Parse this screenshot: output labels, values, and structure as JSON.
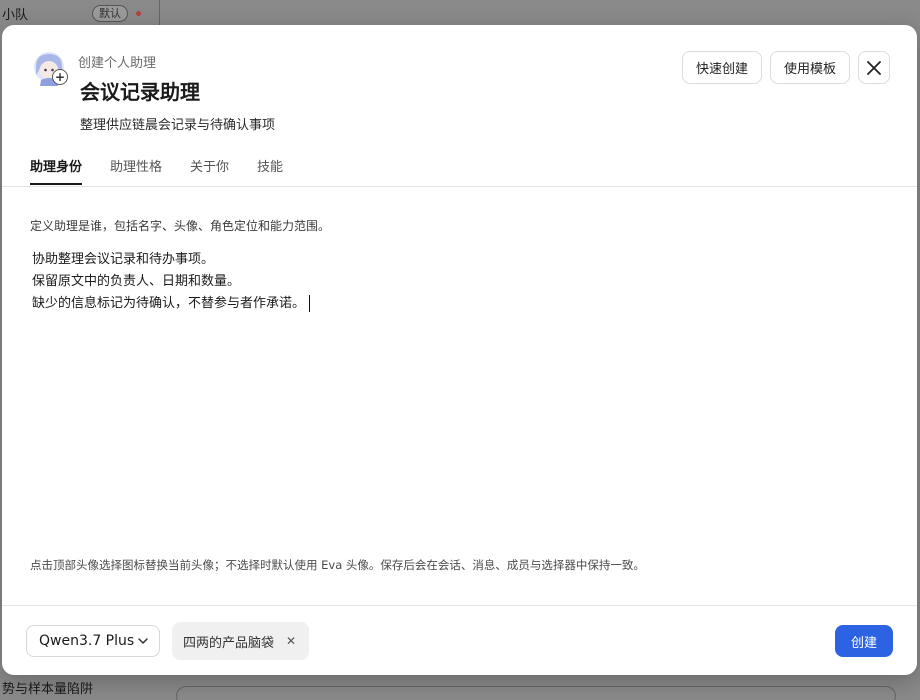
{
  "background": {
    "team_name": "小队",
    "default_badge": "默认",
    "bottom_text": "势与样本量陷阱"
  },
  "modal": {
    "subtitle": "创建个人助理",
    "title": "会议记录助理",
    "description": "整理供应链晨会记录与待确认事项",
    "buttons": {
      "quick_create": "快速创建",
      "use_template": "使用模板",
      "close_icon": "close-icon"
    },
    "tabs": [
      {
        "label": "助理身份",
        "active": true
      },
      {
        "label": "助理性格",
        "active": false
      },
      {
        "label": "关于你",
        "active": false
      },
      {
        "label": "技能",
        "active": false
      }
    ],
    "section_description": "定义助理是谁，包括名字、头像、角色定位和能力范围。",
    "editor_lines": [
      "协助整理会议记录和待办事项。",
      "保留原文中的负责人、日期和数量。",
      "缺少的信息标记为待确认，不替参与者作承诺。"
    ],
    "hint": "点击顶部头像选择图标替换当前头像；不选择时默认使用 Eva 头像。保存后会在会话、消息、成员与选择器中保持一致。",
    "footer": {
      "model": "Qwen3.7 Plus",
      "chip": "四两的产品脑袋",
      "create": "创建"
    }
  },
  "colors": {
    "primary": "#2d63e2",
    "accent_dot": "#b3443b"
  }
}
